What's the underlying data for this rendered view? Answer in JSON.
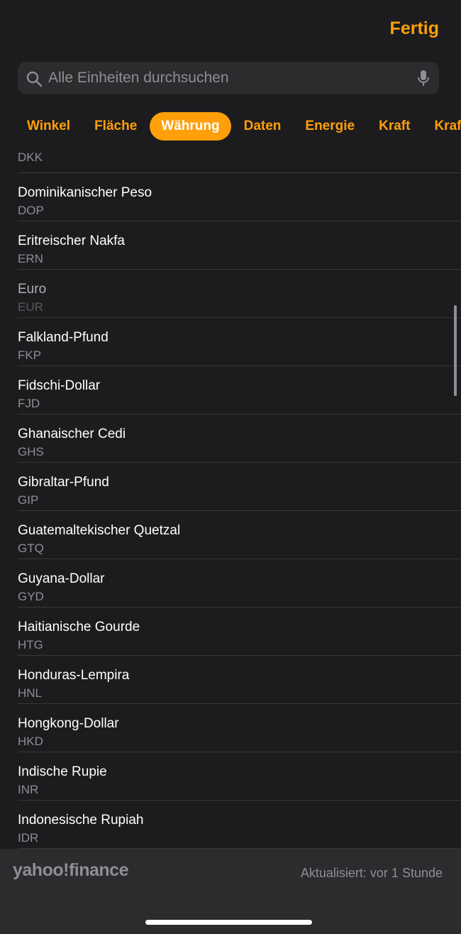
{
  "header": {
    "done_label": "Fertig"
  },
  "search": {
    "placeholder": "Alle Einheiten durchsuchen",
    "icon": "search-icon",
    "mic_icon": "microphone-icon"
  },
  "tabs": [
    "Winkel",
    "Fläche",
    "Währung",
    "Daten",
    "Energie",
    "Kraft",
    "Krafts"
  ],
  "active_tab": "Währung",
  "list": {
    "partial_top_code": "DKK",
    "items": [
      {
        "name": "Dominikanischer Peso",
        "code": "DOP"
      },
      {
        "name": "Eritreischer Nakfa",
        "code": "ERN"
      },
      {
        "name": "Euro",
        "code": "EUR"
      },
      {
        "name": "Falkland-Pfund",
        "code": "FKP"
      },
      {
        "name": "Fidschi-Dollar",
        "code": "FJD"
      },
      {
        "name": "Ghanaischer Cedi",
        "code": "GHS"
      },
      {
        "name": "Gibraltar-Pfund",
        "code": "GIP"
      },
      {
        "name": "Guatemaltekischer Quetzal",
        "code": "GTQ"
      },
      {
        "name": "Guyana-Dollar",
        "code": "GYD"
      },
      {
        "name": "Haitianische Gourde",
        "code": "HTG"
      },
      {
        "name": "Honduras-Lempira",
        "code": "HNL"
      },
      {
        "name": "Hongkong-Dollar",
        "code": "HKD"
      },
      {
        "name": "Indische Rupie",
        "code": "INR"
      },
      {
        "name": "Indonesische Rupiah",
        "code": "IDR"
      }
    ]
  },
  "footer": {
    "logo": "yahoo!finance",
    "updated": "Aktualisiert: vor 1 Stunde"
  },
  "colors": {
    "accent": "#ff9f0a",
    "background": "#1c1c1e",
    "secondary_text": "#8e8e93"
  }
}
